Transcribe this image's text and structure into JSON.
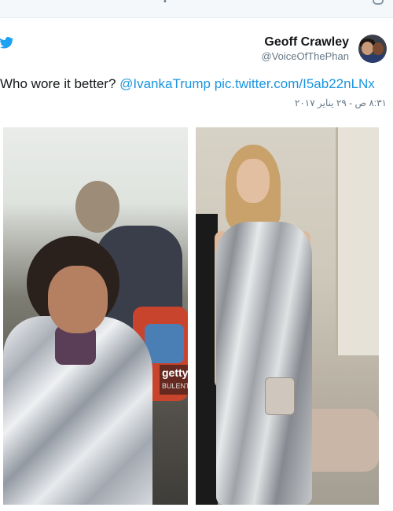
{
  "tweet": {
    "author": {
      "name": "Geoff Crawley",
      "handle": "@VoiceOfThePhan"
    },
    "text": "Who wore it better? ",
    "mention": "@IvankaTrump",
    "link": "pic.twitter.com/I5ab22nLNx",
    "timestamp": "٨:٣١ ص - ٢٩ يناير ٢٠١٧"
  },
  "photos": {
    "left": {
      "watermark": {
        "brand": "getty",
        "credit": "BULENT"
      }
    }
  },
  "colors": {
    "link": "#1b95e0",
    "twitter_blue": "#1da1f2",
    "secondary_text": "#657786"
  },
  "icons": {
    "logo": "twitter-bird-icon",
    "top_right": "caret-icon"
  }
}
